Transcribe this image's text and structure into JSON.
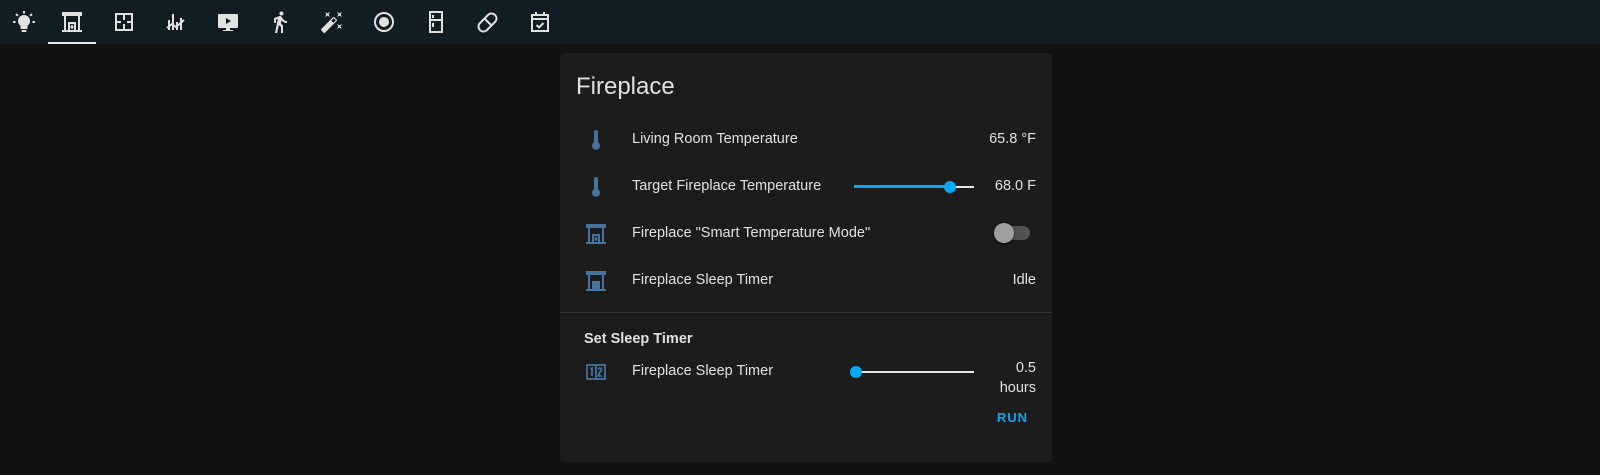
{
  "tabs": [
    {
      "icon": "lightbulb-icon"
    },
    {
      "icon": "fireplace-icon",
      "active": true
    },
    {
      "icon": "floor-plan-icon"
    },
    {
      "icon": "chart-icon"
    },
    {
      "icon": "tv-icon"
    },
    {
      "icon": "motion-run-icon"
    },
    {
      "icon": "magic-wand-icon"
    },
    {
      "icon": "robot-vacuum-icon"
    },
    {
      "icon": "fridge-icon"
    },
    {
      "icon": "pill-icon"
    },
    {
      "icon": "calendar-check-icon"
    }
  ],
  "card": {
    "title": "Fireplace",
    "rows": {
      "living_temp": {
        "label": "Living Room Temperature",
        "value": "65.8 °F",
        "icon": "thermometer-icon"
      },
      "target_temp": {
        "label": "Target Fireplace Temperature",
        "value": "68.0 F",
        "icon": "thermometer-icon",
        "slider_fraction": 0.8
      },
      "smart_mode": {
        "label": "Fireplace \"Smart Temperature Mode\"",
        "icon": "fireplace-icon",
        "toggle_on": false
      },
      "sleep_timer_status": {
        "label": "Fireplace Sleep Timer",
        "value": "Idle",
        "icon": "fireplace-off-icon"
      }
    },
    "section_title": "Set Sleep Timer",
    "sleep_timer_input": {
      "label": "Fireplace Sleep Timer",
      "value_number": "0.5",
      "value_unit": "hours",
      "icon": "numeric-input-icon",
      "slider_fraction": 0.02
    },
    "run_label": "RUN"
  },
  "colors": {
    "accent": "#03a9f4",
    "icon": "#44739e",
    "topbar": "#101e24",
    "background": "#111111",
    "card": "#1c1c1c"
  }
}
